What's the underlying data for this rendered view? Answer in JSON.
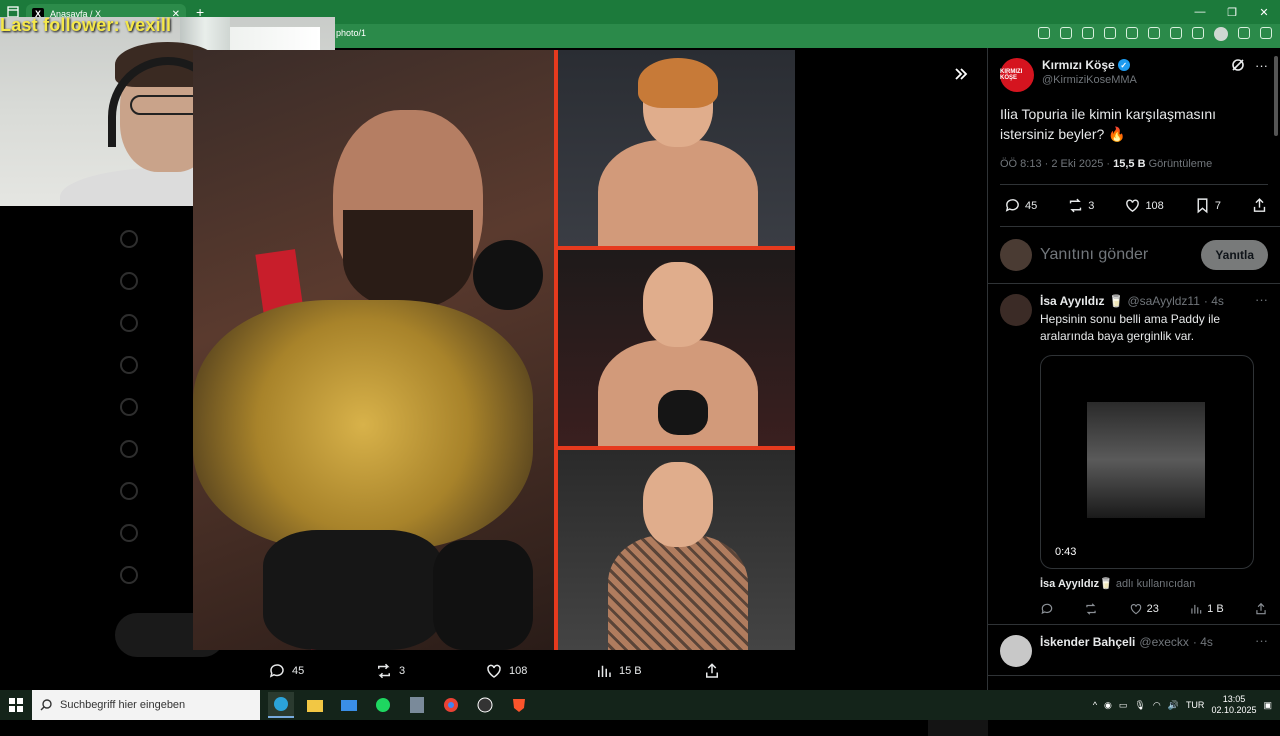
{
  "browser": {
    "tab_title": "Anasayfa / X",
    "url_fragment": "photo/1"
  },
  "overlay": {
    "follower_text": "Last follower: vexill"
  },
  "media_bar": {
    "replies": "45",
    "reposts": "3",
    "likes": "108",
    "views": "15 B"
  },
  "tweet": {
    "author_name": "Kırmızı Köşe",
    "author_handle": "@KirmiziKoseMMA",
    "avatar_text": "KIRMIZI KÖŞE",
    "text": "Ilia Topuria ile kimin karşılaşmasını istersiniz beyler? 🔥",
    "time": "ÖÖ 8:13 · 2 Eki 2025 · ",
    "views_count": "15,5 B",
    "views_label": " Görüntüleme",
    "replies": "45",
    "reposts": "3",
    "likes": "108",
    "bookmarks": "7"
  },
  "reply_box": {
    "placeholder": "Yanıtını gönder",
    "button": "Yanıtla"
  },
  "replies": [
    {
      "name": "İsa Ayyıldız",
      "badge": "🥛",
      "handle": "@saAyyldz11",
      "time": "· 4s",
      "text": "Hepsinin sonu belli ama Paddy ile aralarında baya gerginlik var.",
      "video_duration": "0:43",
      "from_name": "İsa Ayyıldız",
      "from_badge": "🥛",
      "from_suffix": " adlı kullanıcıdan",
      "replies": "",
      "reposts": "",
      "likes": "23",
      "views": "1 B"
    },
    {
      "name": "İskender Bahçeli",
      "handle": "@execkx",
      "time": "· 4s"
    }
  ],
  "taskbar": {
    "search_placeholder": "Suchbegriff hier eingeben",
    "lang": "TUR",
    "time": "13:05",
    "date": "02.10.2025"
  },
  "colors": {
    "browser_green": "#1c7a3b",
    "accent_red": "#e63a1e",
    "verified_blue": "#1d9bf0"
  }
}
